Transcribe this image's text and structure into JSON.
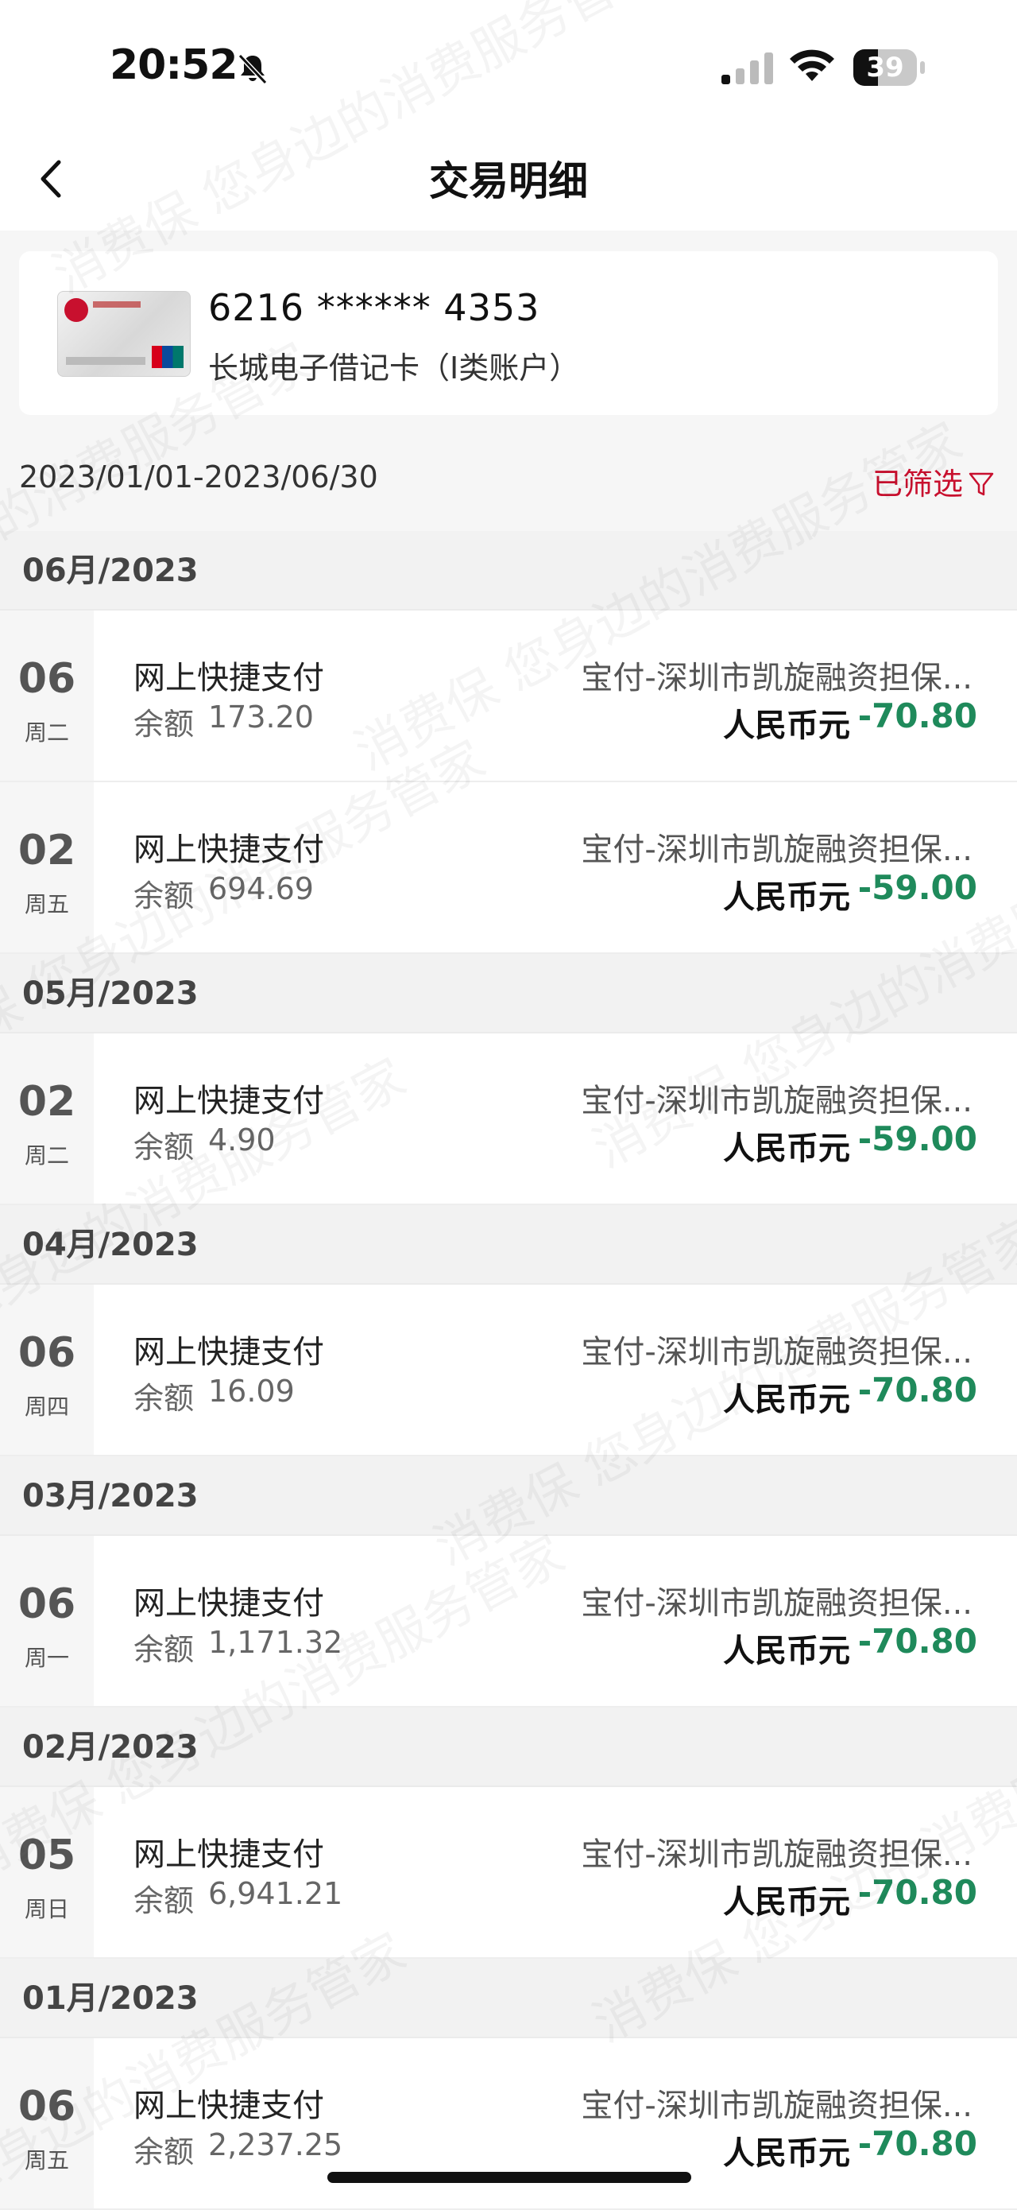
{
  "status_bar": {
    "time": "20:52",
    "battery": "39",
    "battery_level": 0.39
  },
  "nav": {
    "title": "交易明细"
  },
  "account_card": {
    "number": "6216 ****** 4353",
    "name": "长城电子借记卡（I类账户）"
  },
  "filter": {
    "date_range": "2023/01/01-2023/06/30",
    "filter_label": "已筛选"
  },
  "groups": [
    {
      "month": "06月/2023",
      "transactions": [
        {
          "day": "06",
          "weekday": "周二",
          "type": "网上快捷支付",
          "balance_label": "余额",
          "balance": "173.20",
          "merchant": "宝付-深圳市凯旋融资担保...",
          "currency": "人民币元",
          "amount": "-70.80"
        },
        {
          "day": "02",
          "weekday": "周五",
          "type": "网上快捷支付",
          "balance_label": "余额",
          "balance": "694.69",
          "merchant": "宝付-深圳市凯旋融资担保...",
          "currency": "人民币元",
          "amount": "-59.00"
        }
      ]
    },
    {
      "month": "05月/2023",
      "transactions": [
        {
          "day": "02",
          "weekday": "周二",
          "type": "网上快捷支付",
          "balance_label": "余额",
          "balance": "4.90",
          "merchant": "宝付-深圳市凯旋融资担保...",
          "currency": "人民币元",
          "amount": "-59.00"
        }
      ]
    },
    {
      "month": "04月/2023",
      "transactions": [
        {
          "day": "06",
          "weekday": "周四",
          "type": "网上快捷支付",
          "balance_label": "余额",
          "balance": "16.09",
          "merchant": "宝付-深圳市凯旋融资担保...",
          "currency": "人民币元",
          "amount": "-70.80"
        }
      ]
    },
    {
      "month": "03月/2023",
      "transactions": [
        {
          "day": "06",
          "weekday": "周一",
          "type": "网上快捷支付",
          "balance_label": "余额",
          "balance": "1,171.32",
          "merchant": "宝付-深圳市凯旋融资担保...",
          "currency": "人民币元",
          "amount": "-70.80"
        }
      ]
    },
    {
      "month": "02月/2023",
      "transactions": [
        {
          "day": "05",
          "weekday": "周日",
          "type": "网上快捷支付",
          "balance_label": "余额",
          "balance": "6,941.21",
          "merchant": "宝付-深圳市凯旋融资担保...",
          "currency": "人民币元",
          "amount": "-70.80"
        }
      ]
    },
    {
      "month": "01月/2023",
      "transactions": [
        {
          "day": "06",
          "weekday": "周五",
          "type": "网上快捷支付",
          "balance_label": "余额",
          "balance": "2,237.25",
          "merchant": "宝付-深圳市凯旋融资担保...",
          "currency": "人民币元",
          "amount": "-70.80"
        }
      ]
    }
  ],
  "watermark": {
    "text": "消费保 您身边的消费服务管家"
  },
  "colors": {
    "accent": "#c8102e",
    "amount": "#1f8a5b"
  }
}
